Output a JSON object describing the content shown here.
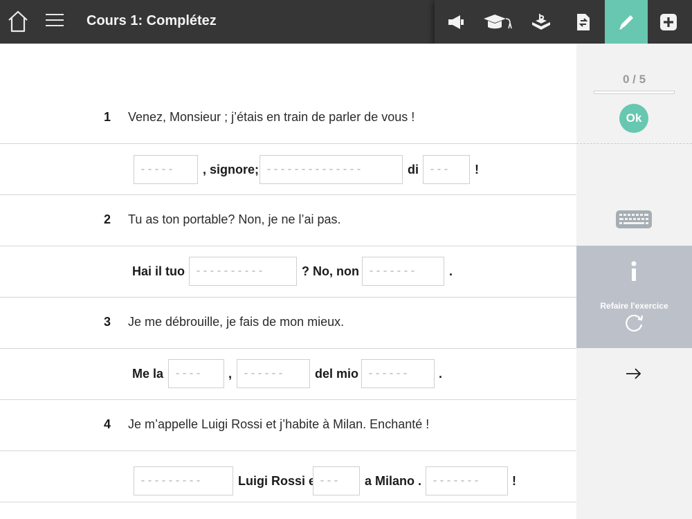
{
  "header": {
    "title": "Cours 1: Complétez"
  },
  "toolbar": {
    "items": [
      {
        "icon": "megaphone-icon"
      },
      {
        "icon": "graduation-cap-icon"
      },
      {
        "icon": "book-hand-icon"
      },
      {
        "icon": "document-swap-icon"
      },
      {
        "icon": "pencil-icon",
        "active": true
      },
      {
        "icon": "plus-icon"
      }
    ],
    "accent": "#67c7b0"
  },
  "exercise": {
    "questions": [
      {
        "number": "1",
        "prompt": "Venez, Monsieur ; j’étais en train de parler de vous !",
        "answer": [
          {
            "blank": "-----"
          },
          {
            "text": ", signore;"
          },
          {
            "blank": "--------------"
          },
          {
            "text": "di"
          },
          {
            "blank": "---"
          },
          {
            "text": "!"
          }
        ]
      },
      {
        "number": "2",
        "prompt": "Tu as ton portable? Non, je ne l’ai pas.",
        "answer": [
          {
            "text": "Hai il tuo"
          },
          {
            "blank": "----------"
          },
          {
            "text": "? No, non"
          },
          {
            "blank": "-------"
          },
          {
            "text": "."
          }
        ]
      },
      {
        "number": "3",
        "prompt": "Je me débrouille, je fais de mon mieux.",
        "answer": [
          {
            "text": "Me la"
          },
          {
            "blank": "----"
          },
          {
            "text": ","
          },
          {
            "blank": "------"
          },
          {
            "text": "del mio"
          },
          {
            "blank": "------"
          },
          {
            "text": "."
          }
        ]
      },
      {
        "number": "4",
        "prompt": "Je m’appelle Luigi Rossi et j’habite à Milan. Enchanté !",
        "answer": [
          {
            "blank": "---------"
          },
          {
            "text": "Luigi Rossi e"
          },
          {
            "blank": "---"
          },
          {
            "text": "a Milano ."
          },
          {
            "blank": "-------"
          },
          {
            "text": "!"
          }
        ]
      }
    ]
  },
  "sidebar": {
    "score": "0 / 5",
    "progress_fraction": 0,
    "ok_label": "Ok",
    "redo_label": "Refaire l'exercice"
  }
}
